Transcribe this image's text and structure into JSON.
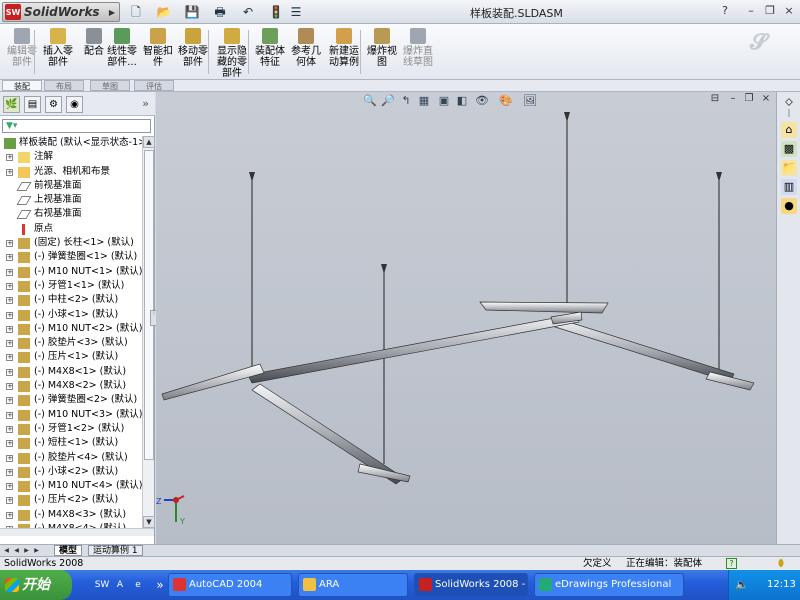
{
  "app": {
    "logo_text": "SolidWorks",
    "logo_badge": "SW",
    "document_title": "样板装配.SLDASM",
    "help": "?",
    "minimize": "–",
    "restore": "❐",
    "close": "×"
  },
  "command_manager": {
    "buttons": [
      {
        "label1": "编辑零",
        "label2": "部件",
        "enabled": false,
        "color": "#9ea6b2"
      },
      {
        "label1": "插入零",
        "label2": "部件",
        "enabled": true,
        "color": "#d8b24a"
      },
      {
        "label1": "配合",
        "label2": "",
        "enabled": true,
        "color": "#8a8f98"
      },
      {
        "label1": "线性零",
        "label2": "部件...",
        "enabled": true,
        "color": "#5a9a5a"
      },
      {
        "label1": "智能扣",
        "label2": "件",
        "enabled": true,
        "color": "#caa24a"
      },
      {
        "label1": "移动零",
        "label2": "部件",
        "enabled": true,
        "color": "#c9a43c"
      },
      {
        "label1": "显示隐",
        "label2": "藏的零",
        "label3": "部件",
        "enabled": true,
        "color": "#d1aa41"
      },
      {
        "label1": "装配体",
        "label2": "特征",
        "enabled": true,
        "color": "#6e9e5c"
      },
      {
        "label1": "参考几",
        "label2": "何体",
        "enabled": true,
        "color": "#b18a55"
      },
      {
        "label1": "新建运",
        "label2": "动算例",
        "enabled": true,
        "color": "#d2a04b"
      },
      {
        "label1": "爆炸视",
        "label2": "图",
        "enabled": true,
        "color": "#b89a55"
      },
      {
        "label1": "爆炸直",
        "label2": "线草图",
        "enabled": false,
        "color": "#9ea6b2"
      }
    ],
    "tabs": [
      "装配",
      "布局",
      "草图",
      "评估"
    ]
  },
  "feature_manager": {
    "filter_icon": "filter-icon",
    "root": "样板装配 (默认<显示状态-1>",
    "items": [
      {
        "label": "注解",
        "expand": true,
        "icon": "annotation"
      },
      {
        "label": "光源、相机和布景",
        "expand": true,
        "icon": "folder"
      },
      {
        "label": "前视基准面",
        "expand": false,
        "icon": "plane"
      },
      {
        "label": "上视基准面",
        "expand": false,
        "icon": "plane"
      },
      {
        "label": "右视基准面",
        "expand": false,
        "icon": "plane"
      },
      {
        "label": "原点",
        "expand": false,
        "icon": "origin"
      },
      {
        "label": "(固定) 长柱<1> (默认)",
        "expand": true,
        "icon": "part"
      },
      {
        "label": "(-) 弹簧垫圈<1> (默认)",
        "expand": true,
        "icon": "part"
      },
      {
        "label": "(-) M10 NUT<1> (默认)",
        "expand": true,
        "icon": "part"
      },
      {
        "label": "(-) 牙管1<1> (默认)",
        "expand": true,
        "icon": "part"
      },
      {
        "label": "(-) 中柱<2> (默认)",
        "expand": true,
        "icon": "part"
      },
      {
        "label": "(-) 小球<1> (默认)",
        "expand": true,
        "icon": "part"
      },
      {
        "label": "(-) M10 NUT<2> (默认)",
        "expand": true,
        "icon": "part"
      },
      {
        "label": "(-) 胶垫片<3> (默认)",
        "expand": true,
        "icon": "part"
      },
      {
        "label": "(-) 压片<1> (默认)",
        "expand": true,
        "icon": "part"
      },
      {
        "label": "(-) M4X8<1> (默认)",
        "expand": true,
        "icon": "part"
      },
      {
        "label": "(-) M4X8<2> (默认)",
        "expand": true,
        "icon": "part"
      },
      {
        "label": "(-) 弹簧垫圈<2> (默认)",
        "expand": true,
        "icon": "part"
      },
      {
        "label": "(-) M10 NUT<3> (默认)",
        "expand": true,
        "icon": "part"
      },
      {
        "label": "(-) 牙管1<2> (默认)",
        "expand": true,
        "icon": "part"
      },
      {
        "label": "(-) 短柱<1> (默认)",
        "expand": true,
        "icon": "part"
      },
      {
        "label": "(-) 胶垫片<4> (默认)",
        "expand": true,
        "icon": "part"
      },
      {
        "label": "(-) 小球<2> (默认)",
        "expand": true,
        "icon": "part"
      },
      {
        "label": "(-) M10 NUT<4> (默认)",
        "expand": true,
        "icon": "part"
      },
      {
        "label": "(-) 压片<2> (默认)",
        "expand": true,
        "icon": "part"
      },
      {
        "label": "(-) M4X8<3> (默认)",
        "expand": true,
        "icon": "part"
      },
      {
        "label": "(-) M4X8<4> (默认)",
        "expand": true,
        "icon": "part"
      }
    ]
  },
  "model_tabs": [
    "模型",
    "运动算例 1"
  ],
  "status_bar": {
    "app_name": "SolidWorks 2008",
    "state": "欠定义",
    "editing": "正在编辑：装配体",
    "help_icon": "?"
  },
  "taskbar": {
    "start_label": "开始",
    "tasks": [
      {
        "label": "AutoCAD 2004",
        "color": "#d33"
      },
      {
        "label": "ARA",
        "color": "#f0c040"
      },
      {
        "label": "SolidWorks 2008 - [...",
        "color": "#c62020",
        "active": true
      },
      {
        "label": "eDrawings Professional",
        "color": "#2a7"
      }
    ],
    "clock": "12:13"
  },
  "triad": {
    "z": "Z",
    "y": "Y",
    "x": "X"
  }
}
